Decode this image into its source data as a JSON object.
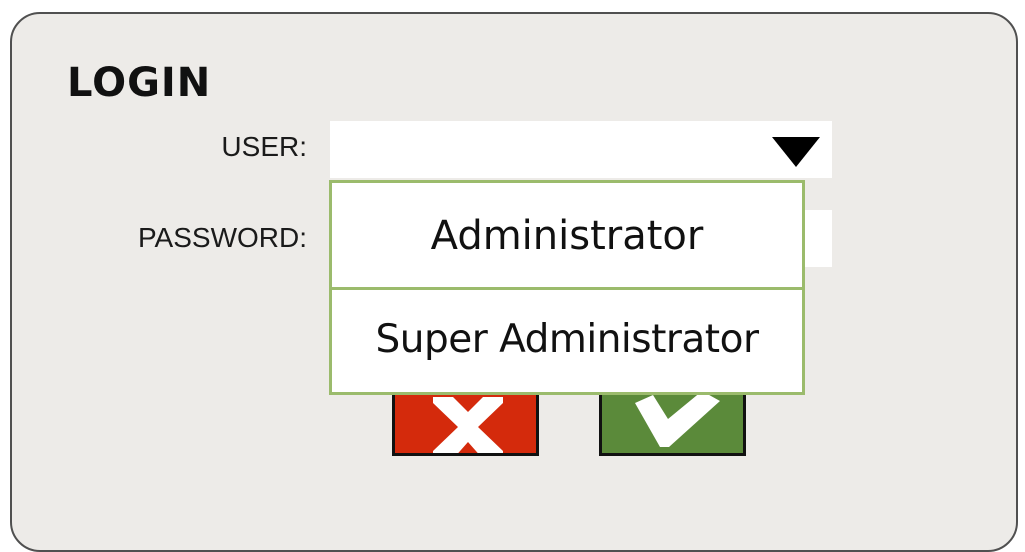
{
  "login": {
    "title": "LOGIN",
    "user_label": "USER:",
    "password_label": "PASSWORD:",
    "user_select": {
      "selected_value": "",
      "options": [
        "Administrator",
        "Super Administrator"
      ],
      "expanded": true,
      "arrow_icon": "triangle-down-icon"
    },
    "password_value": "",
    "buttons": {
      "cancel": {
        "icon": "x-icon",
        "color": "#d42a0c"
      },
      "ok": {
        "icon": "checkmark-icon",
        "color": "#5b8a3a"
      }
    }
  },
  "colors": {
    "panel_background": "#edebe8",
    "dropdown_border": "#9bbb6c"
  }
}
